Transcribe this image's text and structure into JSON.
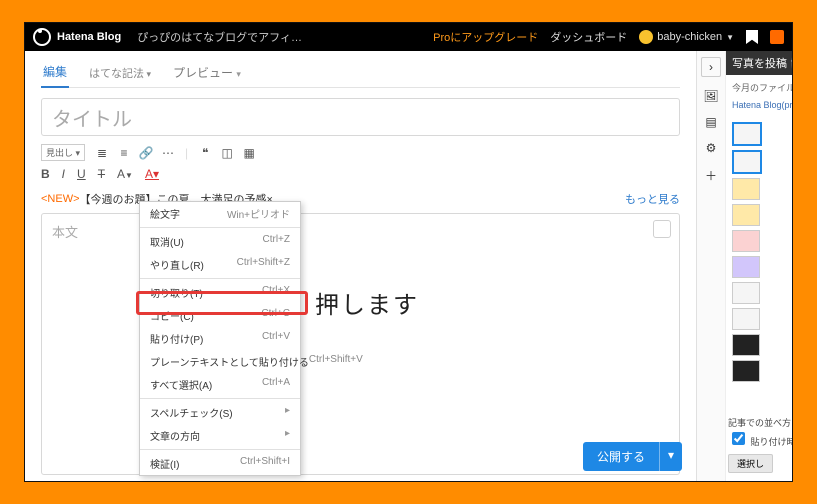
{
  "topbar": {
    "brand": "Hatena Blog",
    "blog_name": "ぴっぴのはてなブログでアフィ…",
    "pro_link": "Proにアップグレード",
    "dashboard": "ダッシュボード",
    "username": "baby-chicken"
  },
  "tabs": {
    "edit": "編集",
    "mode": "はてな記法",
    "preview": "プレビュー"
  },
  "title_placeholder": "タイトル",
  "toolbar": {
    "heading": "見出し"
  },
  "news": {
    "tag": "<NEW>",
    "text": "【今週のお題】この夏、大満足の予感×",
    "more": "もっと見る"
  },
  "body_placeholder": "本文",
  "context_menu": {
    "items": [
      {
        "label": "絵文字",
        "shortcut": "Win+ピリオド",
        "sep_after": true
      },
      {
        "label": "取消(U)",
        "shortcut": "Ctrl+Z"
      },
      {
        "label": "やり直し(R)",
        "shortcut": "Ctrl+Shift+Z",
        "sep_after": true
      },
      {
        "label": "切り取り(T)",
        "shortcut": "Ctrl+X"
      },
      {
        "label": "コピー(C)",
        "shortcut": "Ctrl+C"
      },
      {
        "label": "貼り付け(P)",
        "shortcut": "Ctrl+V",
        "highlight": true
      },
      {
        "label": "プレーンテキストとして貼り付ける",
        "shortcut": "Ctrl+Shift+V"
      },
      {
        "label": "すべて選択(A)",
        "shortcut": "Ctrl+A",
        "sep_after": true
      },
      {
        "label": "スペルチェック(S)",
        "shortcut": "",
        "arrow": true
      },
      {
        "label": "文章の方向",
        "shortcut": "",
        "arrow": true,
        "sep_after": true
      },
      {
        "label": "検証(I)",
        "shortcut": "Ctrl+Shift+I"
      }
    ]
  },
  "annotation": "押します",
  "publish": {
    "label": "公開する"
  },
  "sidebar": {
    "title": "写真を投稿",
    "month_files": "今月のファイル利",
    "link": "Hatena Blog(priva",
    "sort_label": "記事での並べ方",
    "paste_option": "貼り付け時に貼",
    "select_btn": "選択し"
  }
}
